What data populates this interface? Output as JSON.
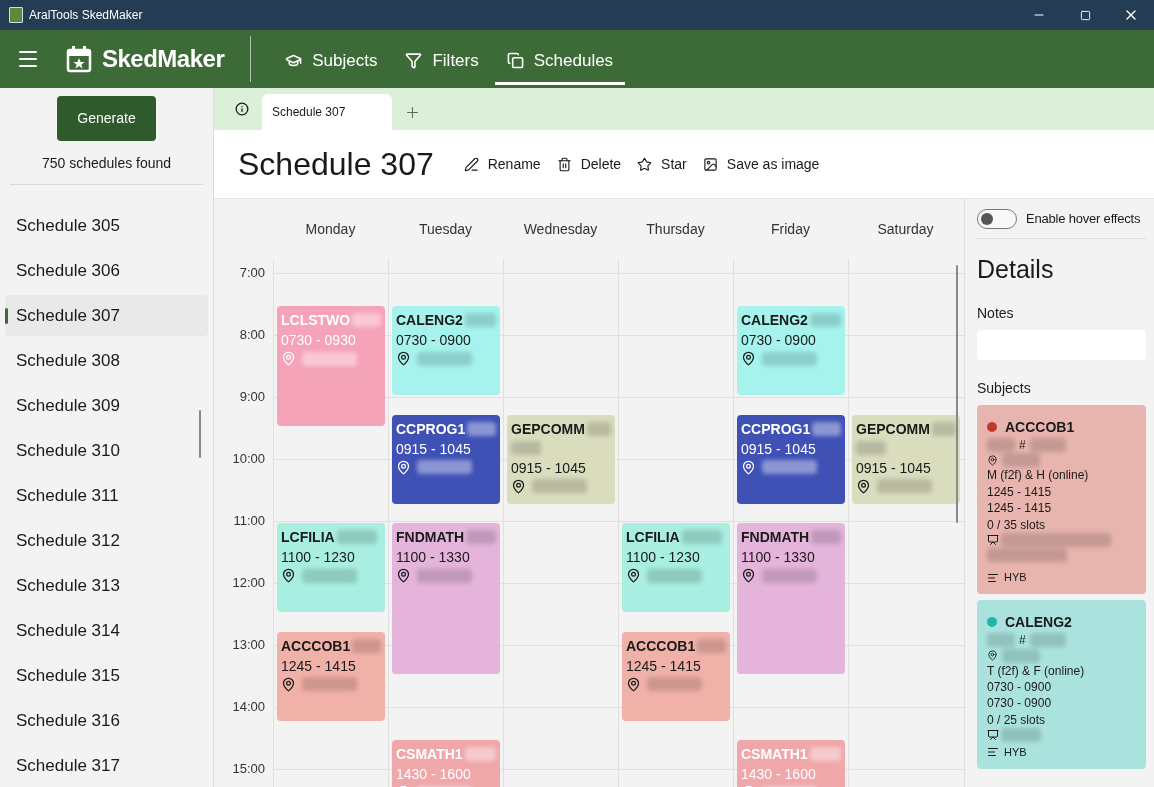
{
  "window": {
    "title": "AralTools SkedMaker"
  },
  "app": {
    "name": "SkedMaker"
  },
  "nav": [
    {
      "label": "Subjects",
      "selected": false
    },
    {
      "label": "Filters",
      "selected": false
    },
    {
      "label": "Schedules",
      "selected": true
    }
  ],
  "sidebar": {
    "generate_button": "Generate",
    "found": "750 schedules found",
    "items": [
      {
        "label": "Schedule 305",
        "selected": false
      },
      {
        "label": "Schedule 306",
        "selected": false
      },
      {
        "label": "Schedule 307",
        "selected": true
      },
      {
        "label": "Schedule 308",
        "selected": false
      },
      {
        "label": "Schedule 309",
        "selected": false
      },
      {
        "label": "Schedule 310",
        "selected": false
      },
      {
        "label": "Schedule 311",
        "selected": false
      },
      {
        "label": "Schedule 312",
        "selected": false
      },
      {
        "label": "Schedule 313",
        "selected": false
      },
      {
        "label": "Schedule 314",
        "selected": false
      },
      {
        "label": "Schedule 315",
        "selected": false
      },
      {
        "label": "Schedule 316",
        "selected": false
      },
      {
        "label": "Schedule 317",
        "selected": false
      }
    ]
  },
  "doc_tabs": [
    {
      "label": "Schedule 307",
      "selected": true
    }
  ],
  "header": {
    "title": "Schedule 307",
    "actions": [
      {
        "label": "Rename"
      },
      {
        "label": "Delete"
      },
      {
        "label": "Star"
      },
      {
        "label": "Save as image"
      }
    ]
  },
  "hours": [
    "7:00",
    "8:00",
    "9:00",
    "10:00",
    "11:00",
    "12:00",
    "13:00",
    "14:00",
    "15:00"
  ],
  "days": [
    {
      "name": "Monday",
      "events": [
        {
          "code": "LCLSTWO",
          "time": "0730 - 0930",
          "color": "#f5a3b8",
          "light_text": true,
          "extra_line": false
        },
        {
          "code": "LCFILIA",
          "time": "1100 - 1230",
          "color": "#a8eee1",
          "light_text": false,
          "extra_line": false
        },
        {
          "code": "ACCCOB1",
          "time": "1245 - 1415",
          "color": "#f0b1a8",
          "light_text": false,
          "extra_line": false
        }
      ]
    },
    {
      "name": "Tuesday",
      "events": [
        {
          "code": "CALENG2",
          "time": "0730 - 0900",
          "color": "#a6f3ee",
          "light_text": false,
          "extra_line": false
        },
        {
          "code": "CCPROG1",
          "time": "0915 - 1045",
          "color": "#3f51b5",
          "light_text": true,
          "extra_line": false
        },
        {
          "code": "FNDMATH",
          "time": "1100 - 1330",
          "color": "#e4b4db",
          "light_text": false,
          "extra_line": false
        },
        {
          "code": "CSMATH1",
          "time": "1430 - 1600",
          "color": "#f0a7aa",
          "light_text": true,
          "extra_line": false
        }
      ]
    },
    {
      "name": "Wednesday",
      "events": [
        {
          "code": "GEPCOMM",
          "time": "0915 - 1045",
          "color": "#d9dcbd",
          "light_text": false,
          "extra_line": true
        }
      ]
    },
    {
      "name": "Thursday",
      "events": [
        {
          "code": "LCFILIA",
          "time": "1100 - 1230",
          "color": "#a8eee1",
          "light_text": false,
          "extra_line": false
        },
        {
          "code": "ACCCOB1",
          "time": "1245 - 1415",
          "color": "#f0b1a8",
          "light_text": false,
          "extra_line": false
        }
      ]
    },
    {
      "name": "Friday",
      "events": [
        {
          "code": "CALENG2",
          "time": "0730 - 0900",
          "color": "#a6f3ee",
          "light_text": false,
          "extra_line": false
        },
        {
          "code": "CCPROG1",
          "time": "0915 - 1045",
          "color": "#3f51b5",
          "light_text": true,
          "extra_line": false
        },
        {
          "code": "FNDMATH",
          "time": "1100 - 1330",
          "color": "#e4b4db",
          "light_text": false,
          "extra_line": false
        },
        {
          "code": "CSMATH1",
          "time": "1430 - 1600",
          "color": "#f0a7aa",
          "light_text": true,
          "extra_line": false
        }
      ]
    },
    {
      "name": "Saturday",
      "events": [
        {
          "code": "GEPCOMM",
          "time": "0915 - 1045",
          "color": "#d9dcbd",
          "light_text": false,
          "extra_line": true
        }
      ]
    }
  ],
  "details": {
    "hover_toggle": {
      "label": "Enable hover effects",
      "on": false
    },
    "title": "Details",
    "notes_label": "Notes",
    "subjects_label": "Subjects",
    "subjects": [
      {
        "code": "ACCCOB1",
        "color": "#c0392b",
        "hash": "#",
        "days": "M (f2f) & H (online)",
        "times": [
          "1245 - 1415",
          "1245 - 1415"
        ],
        "slots": "0 / 35 slots",
        "mode": "HYB"
      },
      {
        "code": "CALENG2",
        "color": "#1fb5a8",
        "hash": "#",
        "days": "T (f2f) & F (online)",
        "times": [
          "0730 - 0900",
          "0730 - 0900"
        ],
        "slots": "0 / 25 slots",
        "mode": "HYB"
      }
    ]
  }
}
